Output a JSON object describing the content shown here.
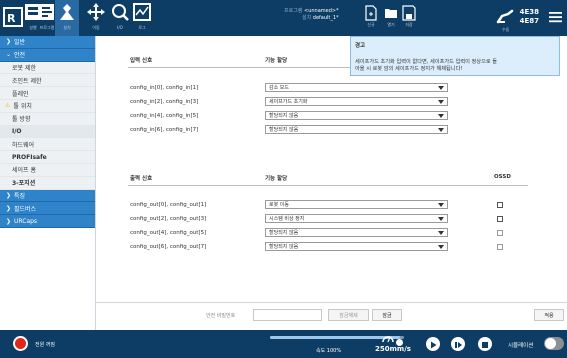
{
  "toolbar": {
    "items": [
      {
        "label": "실행",
        "icon": "run-icon"
      },
      {
        "label": "프로그램",
        "icon": "program-icon"
      },
      {
        "label": "설치",
        "icon": "installation-icon"
      },
      {
        "label": "이동",
        "icon": "move-icon"
      },
      {
        "label": "I/O",
        "icon": "io-icon"
      },
      {
        "label": "로그",
        "icon": "log-icon"
      }
    ],
    "program_key": "프로그램",
    "program_value": "<unnamed>*",
    "installation_key": "설치",
    "installation_value": "default_1*",
    "new_label": "신규",
    "open_label": "열기",
    "save_label": "저장",
    "robot_label": "수동",
    "robot_id_1": "4E38",
    "robot_id_2": "4E87"
  },
  "sidebar": {
    "general": "일반",
    "safety": "안전",
    "items": [
      "로봇 제한",
      "조인트 제한",
      "플레인",
      "툴 위치",
      "툴 방향",
      "I/O",
      "하드웨어",
      "PROFIsafe",
      "세이프 홈",
      "3-포지션"
    ],
    "features": "특징",
    "fieldbus": "필드버스",
    "urcaps": "URCaps"
  },
  "tooltip": {
    "title": "경고",
    "line1": "세이프가드 초기화 입력이 없다면, 세이프가드 입력이 정상으로 돌",
    "line2": "아올 시 로봇 암의 세이프가드 정지가 해제됩니다!"
  },
  "inputs": {
    "col_signal": "입력 신호",
    "col_function": "기능 할당",
    "rows": [
      {
        "label": "config_in[0], config_in[1]",
        "value": "감소 모드"
      },
      {
        "label": "config_in[2], config_in[3]",
        "value": "세이프가드 초기화"
      },
      {
        "label": "config_in[4], config_in[5]",
        "value": "할당되지 않음"
      },
      {
        "label": "config_in[6], config_in[7]",
        "value": "할당되지 않음"
      }
    ]
  },
  "outputs": {
    "col_signal": "출력 신호",
    "col_function": "기능 할당",
    "col_ossd": "OSSD",
    "rows": [
      {
        "label": "config_out[0], config_out[1]",
        "value": "로봇 이동"
      },
      {
        "label": "config_out[2], config_out[3]",
        "value": "시스템 비상 정지"
      },
      {
        "label": "config_out[4], config_out[5]",
        "value": "할당되지 않음"
      },
      {
        "label": "config_out[6], config_out[7]",
        "value": "할당되지 않음"
      }
    ]
  },
  "footer": {
    "password_label": "안전 비밀번호",
    "password_value": "",
    "unlock_label": "잠금해제",
    "lock_label": "잠금",
    "apply_label": "적용"
  },
  "bottombar": {
    "power_label": "전원 꺼짐",
    "speed_label": "속도 100%",
    "speed_fraction": 0.97,
    "speed_value": "250mm/s",
    "simulation_label": "시뮬레이션"
  }
}
